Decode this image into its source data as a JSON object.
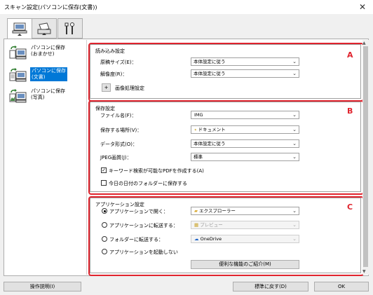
{
  "window": {
    "title": "スキャン設定(パソコンに保存(文書))",
    "close": "✕"
  },
  "tabs": [
    {
      "name": "scan-from-computer"
    },
    {
      "name": "scan-from-panel"
    },
    {
      "name": "general-settings"
    }
  ],
  "left_list": {
    "items": [
      {
        "label1": "パソコンに保存",
        "label2": "(おまかせ)"
      },
      {
        "label1": "パソコンに保存",
        "label2": "(文書)"
      },
      {
        "label1": "パソコンに保存",
        "label2": "(写真)"
      }
    ],
    "selected_index": 1
  },
  "section_a": {
    "title": "読み込み設定",
    "letter": "A",
    "paper_size_label": "原稿サイズ(E)：",
    "paper_size_value": "本体設定に従う",
    "resolution_label": "解像度(R)：",
    "resolution_value": "本体設定に従う",
    "image_processing_plus": "+",
    "image_processing_label": "画像処理設定"
  },
  "section_b": {
    "title": "保存設定",
    "letter": "B",
    "filename_label": "ファイル名(F)：",
    "filename_value": "IMG",
    "save_in_label": "保存する場所(V)：",
    "save_in_value": "ドキュメント",
    "data_format_label": "データ形式(O)：",
    "data_format_value": "本体設定に従う",
    "jpeg_quality_label": "JPEG画質(J)：",
    "jpeg_quality_value": "標準",
    "keyword_pdf_label": "キーワード検索が可能なPDFを作成する(A)",
    "keyword_pdf_checked": "✓",
    "date_folder_label": "今日の日付のフォルダーに保存する"
  },
  "section_c": {
    "title": "アプリケーション設定",
    "letter": "C",
    "open_app_label": "アプリケーションで開く：",
    "open_app_value": "エクスプローラー",
    "send_app_label": "アプリケーションに転送する：",
    "send_app_value": "プレビュー",
    "send_folder_label": "フォルダーに転送する：",
    "send_folder_value": "OneDrive",
    "no_app_label": "アプリケーションを起動しない",
    "more_functions_label": "便利な機能のご紹介(M)"
  },
  "footer": {
    "instructions_label": "操作説明(I)",
    "defaults_label": "標準に戻す(D)",
    "ok_label": "OK"
  },
  "colors": {
    "highlight_red": "#e0242e",
    "selection_blue": "#0078d7"
  }
}
